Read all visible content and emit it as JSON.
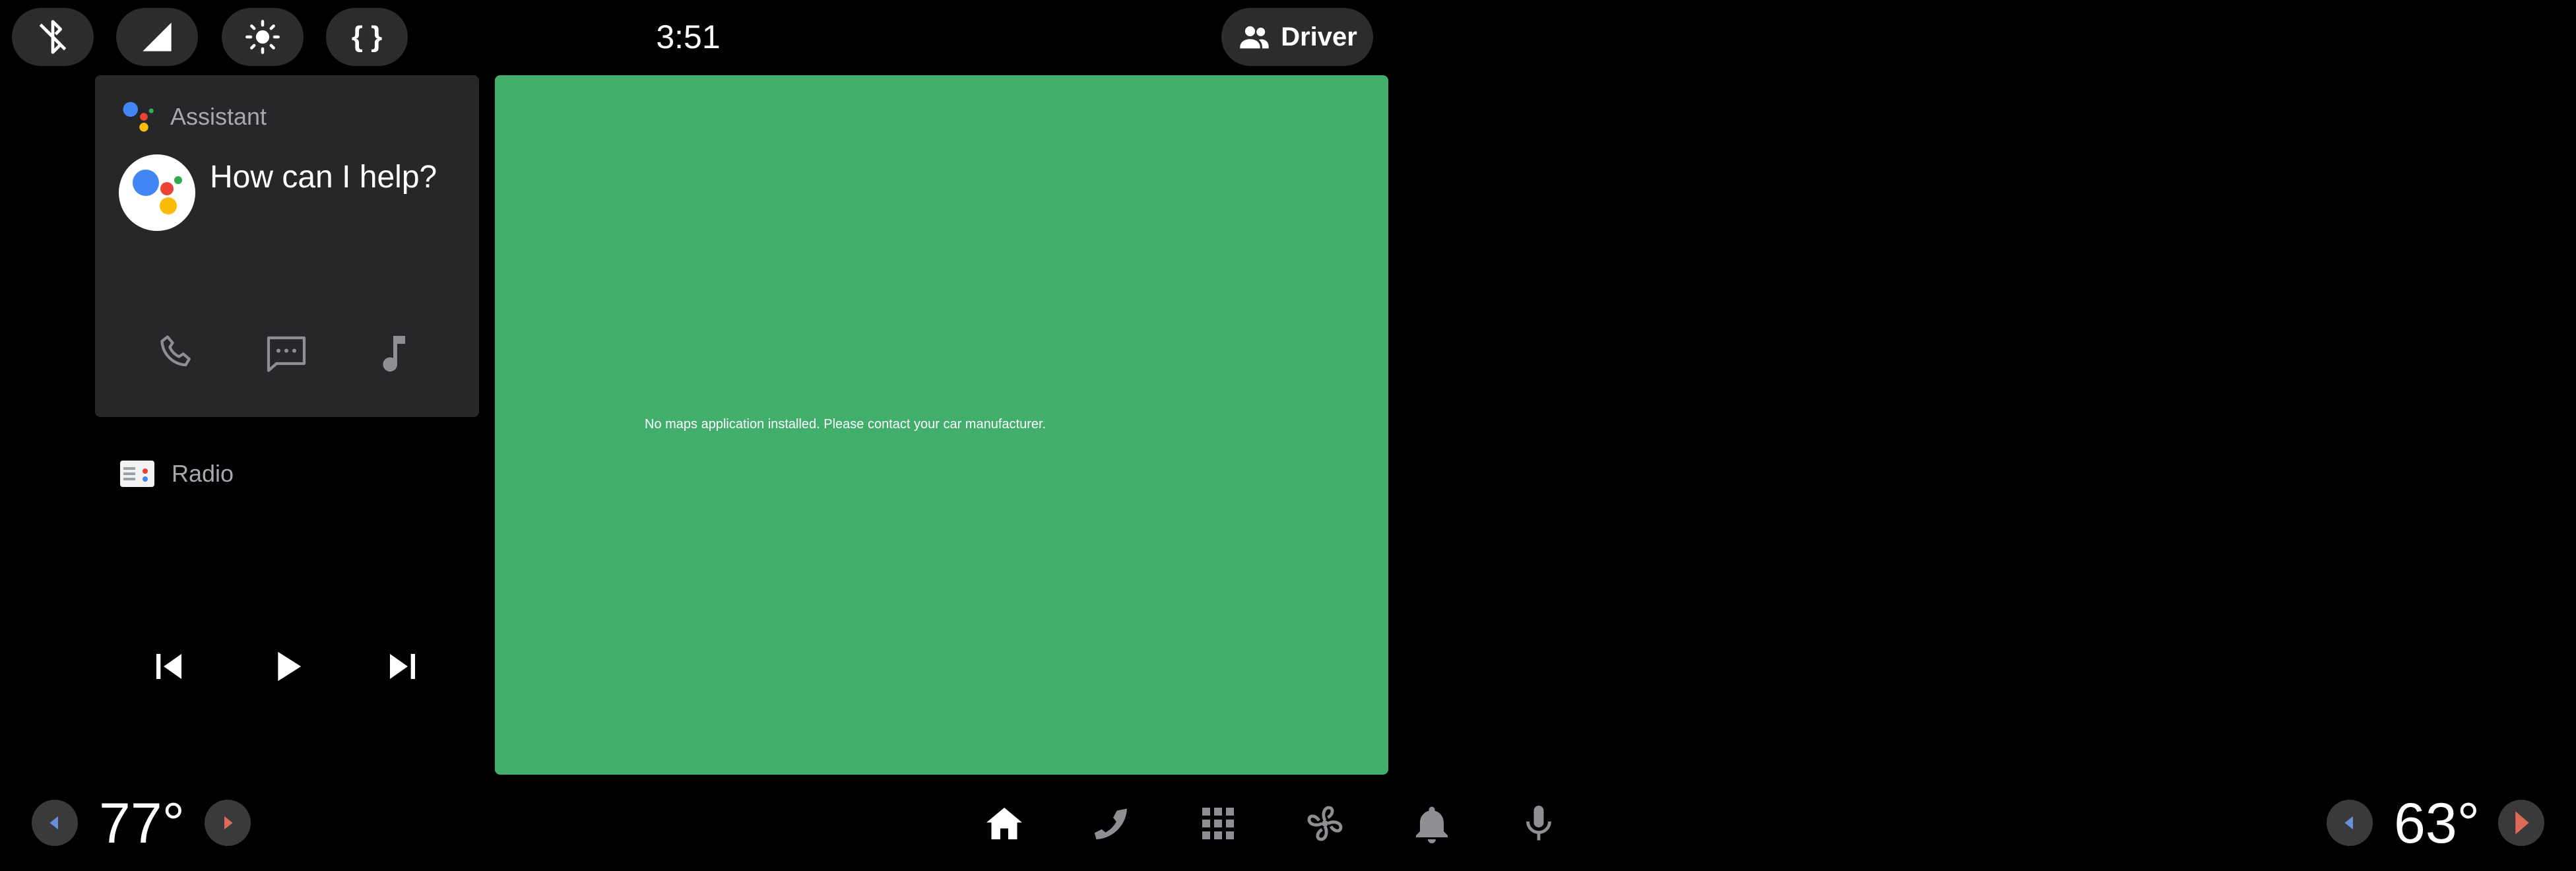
{
  "status_bar": {
    "quick_controls": [
      {
        "icon": "bluetooth-disabled-icon"
      },
      {
        "icon": "cellular-signal-icon"
      },
      {
        "icon": "brightness-icon"
      },
      {
        "icon": "debug-braces-icon",
        "label": "{ }"
      }
    ],
    "clock": "3:51",
    "user_profile": {
      "icon": "people-icon",
      "label": "Driver"
    }
  },
  "assistant_card": {
    "app_name": "Assistant",
    "prompt": "How can I help?",
    "actions": [
      {
        "icon": "phone-icon"
      },
      {
        "icon": "message-icon"
      },
      {
        "icon": "music-note-icon"
      }
    ]
  },
  "media_card": {
    "source_name": "Radio",
    "controls": [
      {
        "icon": "skip-previous-icon"
      },
      {
        "icon": "play-icon"
      },
      {
        "icon": "skip-next-icon"
      }
    ]
  },
  "map_panel": {
    "message": "No maps application installed. Please contact your car manufacturer.",
    "background_color": "#42ae6b"
  },
  "bottom_bar": {
    "driver_temperature": "77°",
    "passenger_temperature": "63°",
    "nav_items": [
      {
        "icon": "home-icon",
        "selected": true
      },
      {
        "icon": "phone-icon"
      },
      {
        "icon": "app-grid-icon"
      },
      {
        "icon": "fan-hvac-icon"
      },
      {
        "icon": "notification-bell-icon"
      },
      {
        "icon": "microphone-icon"
      }
    ]
  },
  "colors": {
    "assistant_blue": "#4285f4",
    "assistant_red": "#ea4335",
    "assistant_yellow": "#fbbc05",
    "assistant_green": "#34a853",
    "temp_down": "#6b8fd6",
    "temp_up": "#e06a5a"
  }
}
